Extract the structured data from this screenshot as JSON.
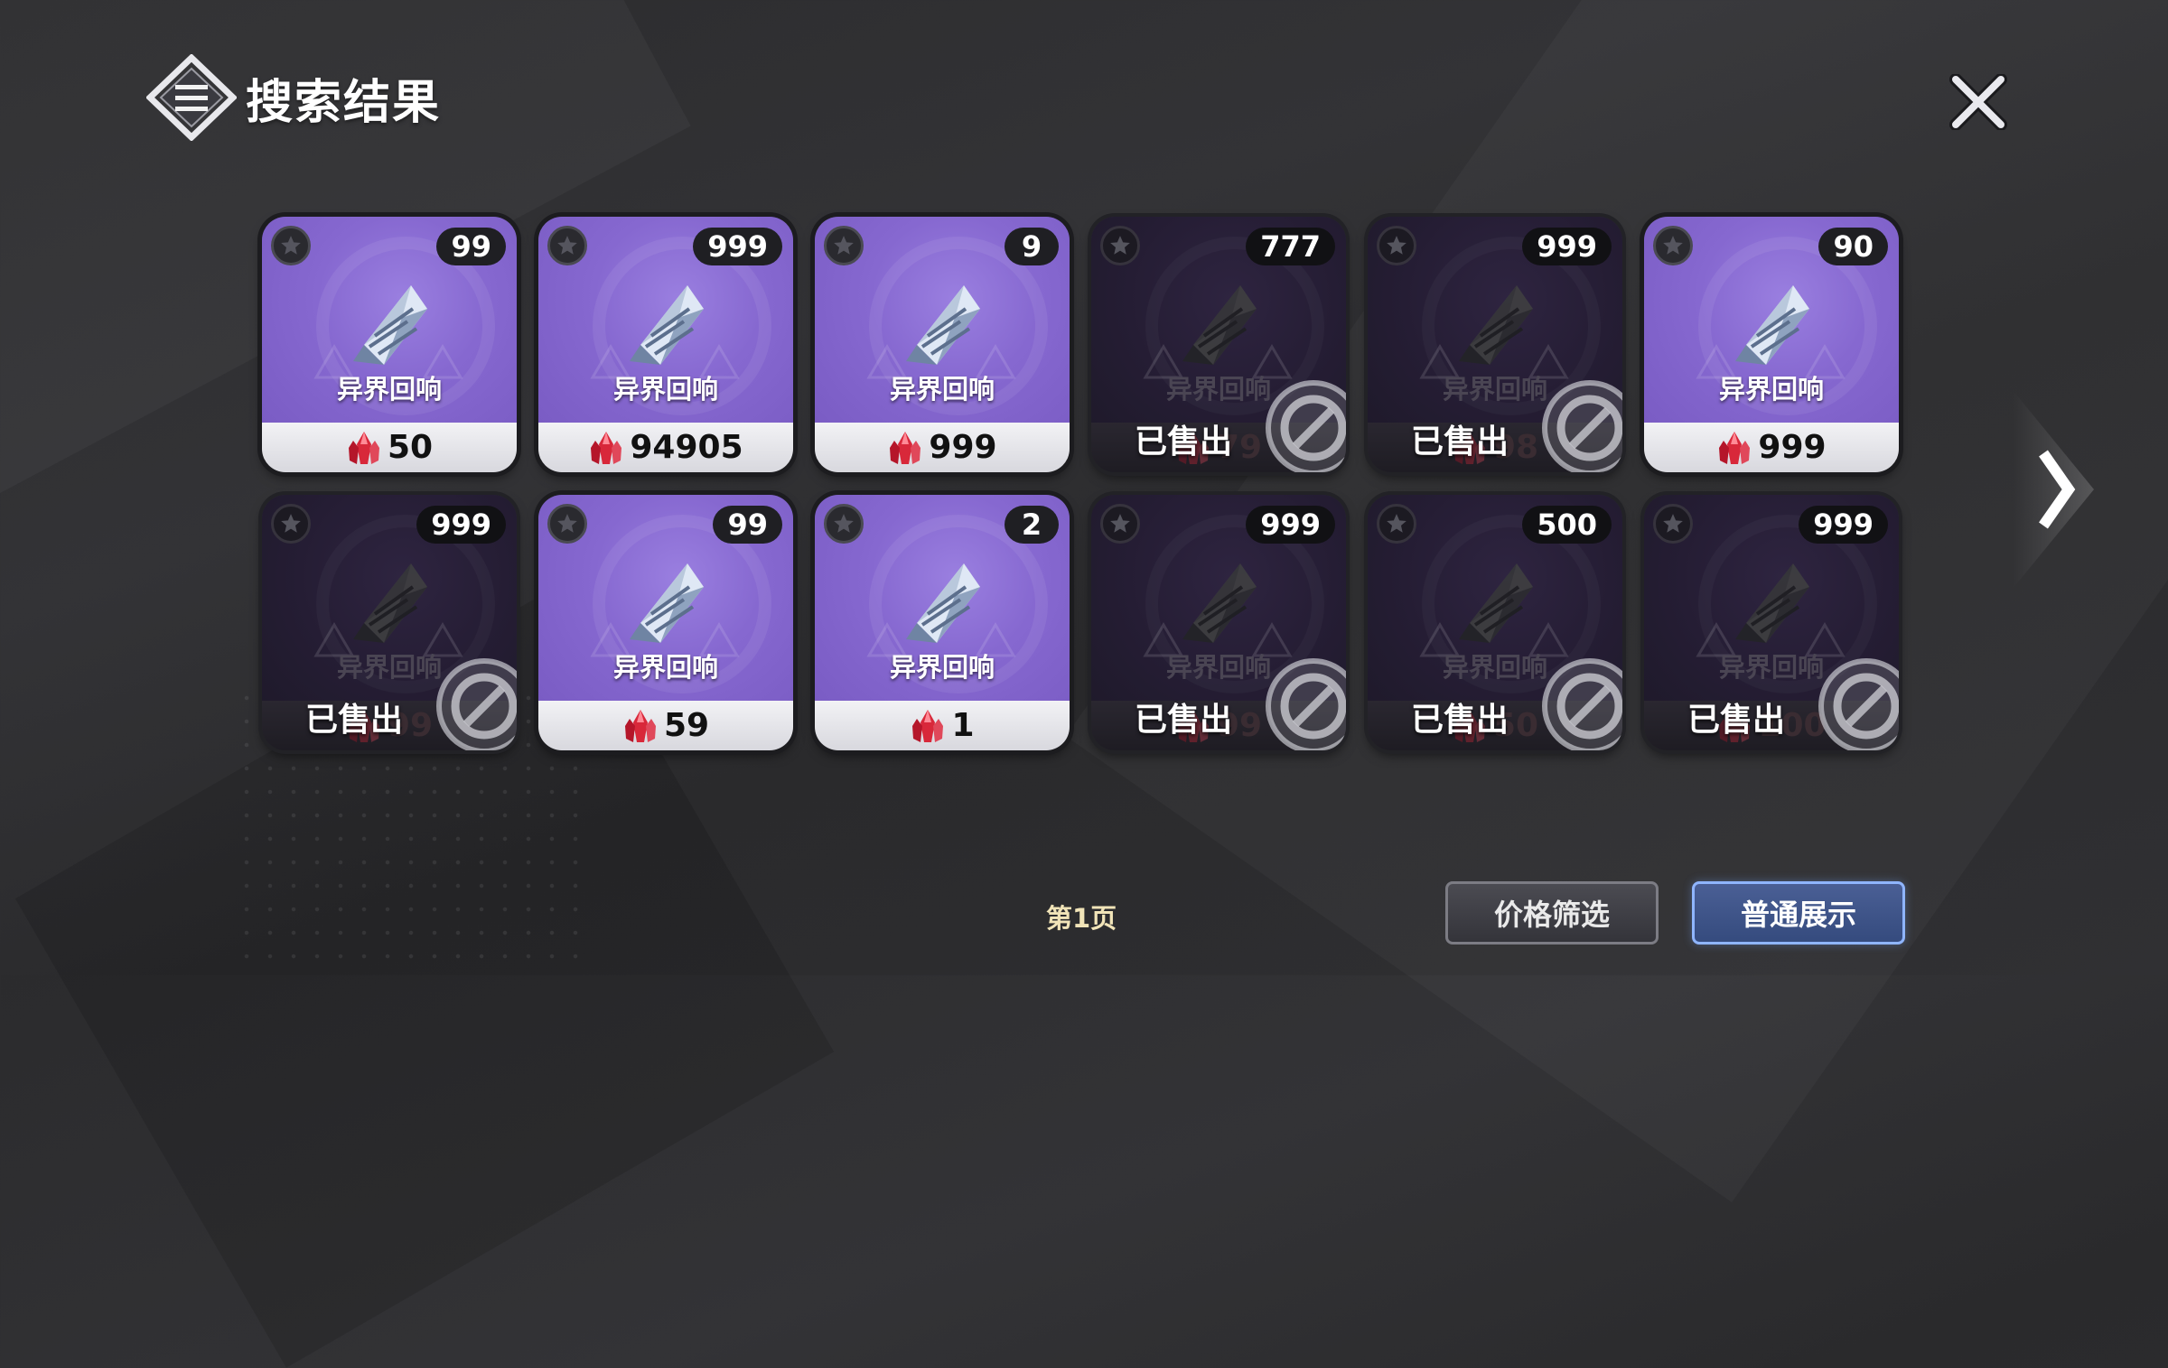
{
  "header": {
    "title": "搜索结果"
  },
  "items": [
    {
      "qty": "99",
      "name": "异界回响",
      "price": "50",
      "sold": false,
      "sold_label": ""
    },
    {
      "qty": "999",
      "name": "异界回响",
      "price": "94905",
      "sold": false,
      "sold_label": ""
    },
    {
      "qty": "9",
      "name": "异界回响",
      "price": "999",
      "sold": false,
      "sold_label": ""
    },
    {
      "qty": "777",
      "name": "异界回响",
      "price": "79",
      "sold": true,
      "sold_label": "已售出"
    },
    {
      "qty": "999",
      "name": "异界回响",
      "price": "98",
      "sold": true,
      "sold_label": "已售出"
    },
    {
      "qty": "90",
      "name": "异界回响",
      "price": "999",
      "sold": false,
      "sold_label": ""
    },
    {
      "qty": "999",
      "name": "异界回响",
      "price": "99",
      "sold": true,
      "sold_label": "已售出"
    },
    {
      "qty": "99",
      "name": "异界回响",
      "price": "59",
      "sold": false,
      "sold_label": ""
    },
    {
      "qty": "2",
      "name": "异界回响",
      "price": "1",
      "sold": false,
      "sold_label": ""
    },
    {
      "qty": "999",
      "name": "异界回响",
      "price": "99",
      "sold": true,
      "sold_label": "已售出"
    },
    {
      "qty": "500",
      "name": "异界回响",
      "price": "50",
      "sold": true,
      "sold_label": "已售出"
    },
    {
      "qty": "999",
      "name": "异界回响",
      "price": "100",
      "sold": true,
      "sold_label": "已售出"
    }
  ],
  "footer": {
    "page_label": "第1页",
    "price_filter_label": "价格筛选",
    "normal_display_label": "普通展示"
  },
  "colors": {
    "card_purple": "#8668d0",
    "card_sold": "#251d34",
    "accent_blue": "#8fb5ff",
    "page_label": "#f1e4b8"
  },
  "icons": {
    "title": "menu-diamond-icon",
    "close": "close-icon",
    "next": "chevron-right-icon",
    "item": "crystal-icon",
    "currency": "red-gem-icon",
    "sold": "prohibited-icon",
    "favorite": "star-icon"
  }
}
